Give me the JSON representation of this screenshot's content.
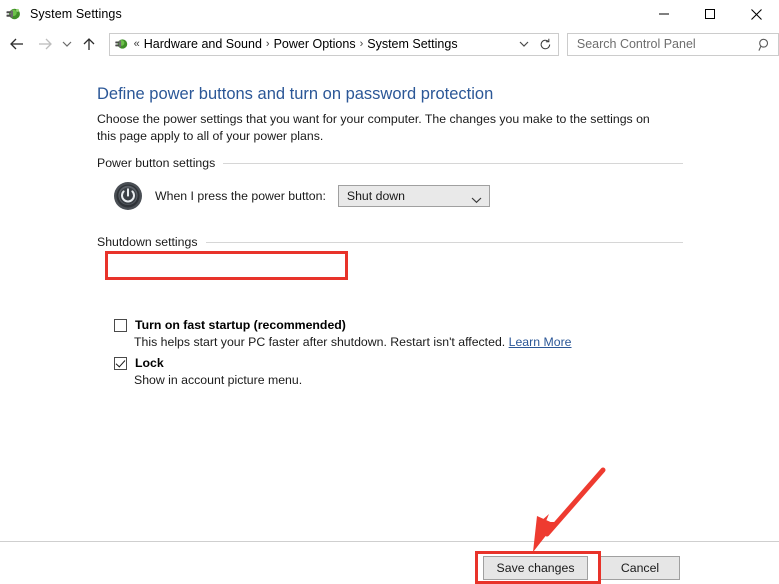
{
  "window": {
    "title": "System Settings",
    "icon": "power-plug-icon",
    "controls": {
      "minimize": "minimize-icon",
      "maximize": "maximize-icon",
      "close": "close-icon"
    }
  },
  "nav": {
    "back": "back-arrow-icon",
    "forward": "forward-arrow-icon",
    "history": "chevron-down-icon",
    "up": "up-arrow-icon",
    "address_icon": "power-plug-icon",
    "breadcrumb_prefix": "«",
    "breadcrumbs": [
      "Hardware and Sound",
      "Power Options",
      "System Settings"
    ],
    "separator": "›",
    "dropdown": "chevron-down-icon",
    "refresh": "refresh-icon"
  },
  "search": {
    "placeholder": "Search Control Panel",
    "value": "",
    "icon": "search-icon"
  },
  "page": {
    "title": "Define power buttons and turn on password protection",
    "description": "Choose the power settings that you want for your computer. The changes you make to the settings on this page apply to all of your power plans."
  },
  "power_button_section": {
    "heading": "Power button settings",
    "icon": "power-button-icon",
    "label": "When I press the power button:",
    "select": {
      "value": "Shut down",
      "arrow": "chevron-down-icon"
    }
  },
  "shutdown_section": {
    "heading": "Shutdown settings",
    "items": [
      {
        "label": "Turn on fast startup (recommended)",
        "checked": false,
        "description": "This helps start your PC faster after shutdown. Restart isn't affected.",
        "link": "Learn More"
      },
      {
        "label": "Lock",
        "checked": true,
        "description": "Show in account picture menu."
      }
    ]
  },
  "footer": {
    "save_label": "Save changes",
    "cancel_label": "Cancel"
  },
  "annotations": {
    "color": "#e8332a",
    "highlight_fast_startup": true,
    "highlight_save_button": true,
    "arrow_to_save_button": true
  },
  "colors": {
    "link": "#2b5797",
    "title": "#2b5797",
    "annotation": "#e8332a",
    "button_face": "#e6e6e6"
  }
}
